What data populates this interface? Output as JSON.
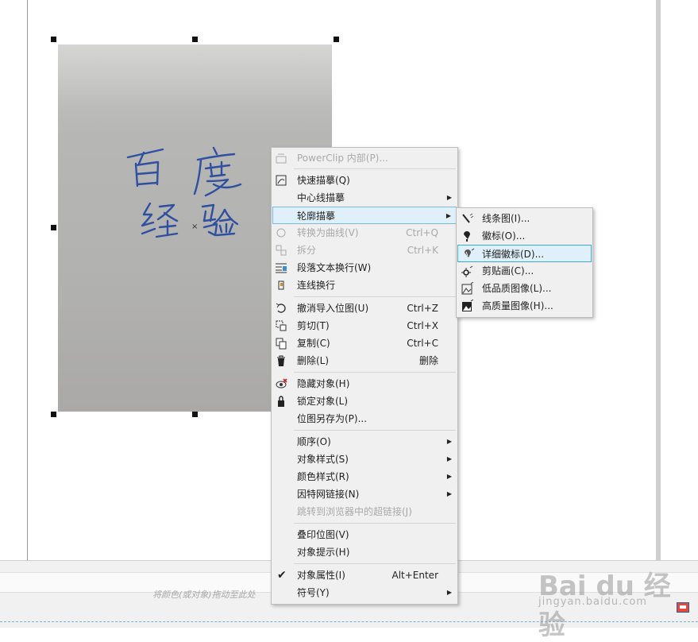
{
  "canvas": {
    "hint_text": "将颜色(或对象)拖动至此处"
  },
  "context_menu": {
    "items": [
      {
        "label": "PowerClip 内部(P)...",
        "shortcut": "",
        "submenu": false,
        "disabled": true,
        "icon": "powerclip-icon"
      },
      {
        "label": "快速描摹(Q)",
        "shortcut": "",
        "submenu": false,
        "disabled": false,
        "icon": "quick-trace-icon"
      },
      {
        "label": "中心线描摹",
        "shortcut": "",
        "submenu": true,
        "disabled": false,
        "icon": ""
      },
      {
        "label": "轮廓描摹",
        "shortcut": "",
        "submenu": true,
        "disabled": false,
        "icon": "",
        "highlighted": true
      },
      {
        "label": "转换为曲线(V)",
        "shortcut": "Ctrl+Q",
        "submenu": false,
        "disabled": true,
        "icon": "convert-curve-icon"
      },
      {
        "label": "拆分",
        "shortcut": "Ctrl+K",
        "submenu": false,
        "disabled": true,
        "icon": "break-apart-icon"
      },
      {
        "label": "段落文本换行(W)",
        "shortcut": "",
        "submenu": false,
        "disabled": false,
        "icon": "text-wrap-icon"
      },
      {
        "label": "连线换行",
        "shortcut": "",
        "submenu": false,
        "disabled": false,
        "icon": "connector-wrap-icon"
      },
      {
        "label": "撤消导入位图(U)",
        "shortcut": "Ctrl+Z",
        "submenu": false,
        "disabled": false,
        "icon": "undo-icon"
      },
      {
        "label": "剪切(T)",
        "shortcut": "Ctrl+X",
        "submenu": false,
        "disabled": false,
        "icon": "cut-icon"
      },
      {
        "label": "复制(C)",
        "shortcut": "Ctrl+C",
        "submenu": false,
        "disabled": false,
        "icon": "copy-icon"
      },
      {
        "label": "删除(L)",
        "shortcut": "删除",
        "submenu": false,
        "disabled": false,
        "icon": "trash-icon"
      },
      {
        "label": "隐藏对象(H)",
        "shortcut": "",
        "submenu": false,
        "disabled": false,
        "icon": "hide-icon"
      },
      {
        "label": "锁定对象(L)",
        "shortcut": "",
        "submenu": false,
        "disabled": false,
        "icon": "lock-icon"
      },
      {
        "label": "位图另存为(P)...",
        "shortcut": "",
        "submenu": false,
        "disabled": false,
        "icon": ""
      },
      {
        "label": "顺序(O)",
        "shortcut": "",
        "submenu": true,
        "disabled": false,
        "icon": ""
      },
      {
        "label": "对象样式(S)",
        "shortcut": "",
        "submenu": true,
        "disabled": false,
        "icon": ""
      },
      {
        "label": "颜色样式(R)",
        "shortcut": "",
        "submenu": true,
        "disabled": false,
        "icon": ""
      },
      {
        "label": "因特网链接(N)",
        "shortcut": "",
        "submenu": true,
        "disabled": false,
        "icon": ""
      },
      {
        "label": "跳转到浏览器中的超链接(J)",
        "shortcut": "",
        "submenu": false,
        "disabled": true,
        "icon": ""
      },
      {
        "label": "叠印位图(V)",
        "shortcut": "",
        "submenu": false,
        "disabled": false,
        "icon": ""
      },
      {
        "label": "对象提示(H)",
        "shortcut": "",
        "submenu": false,
        "disabled": false,
        "icon": ""
      },
      {
        "label": "对象属性(I)",
        "shortcut": "Alt+Enter",
        "submenu": false,
        "disabled": false,
        "icon": "checkmark-icon"
      },
      {
        "label": "符号(Y)",
        "shortcut": "",
        "submenu": true,
        "disabled": false,
        "icon": ""
      }
    ]
  },
  "submenu": {
    "items": [
      {
        "label": "线条图(I)...",
        "icon": "line-art-icon"
      },
      {
        "label": "徽标(O)...",
        "icon": "logo-icon"
      },
      {
        "label": "详细徽标(D)...",
        "icon": "detailed-logo-icon",
        "highlighted": true
      },
      {
        "label": "剪贴画(C)...",
        "icon": "clipart-icon"
      },
      {
        "label": "低品质图像(L)...",
        "icon": "low-quality-image-icon"
      },
      {
        "label": "高质量图像(H)...",
        "icon": "high-quality-image-icon"
      }
    ]
  },
  "photo": {
    "handwriting": [
      "百",
      "度",
      "经",
      "验"
    ]
  },
  "watermark": {
    "brand": "Bai du 经验",
    "url": "jingyan.baidu.com"
  },
  "colors": {
    "ink": "#2f4fa0",
    "highlight": "#dff0fb",
    "highlight_border": "#78b8e3"
  }
}
